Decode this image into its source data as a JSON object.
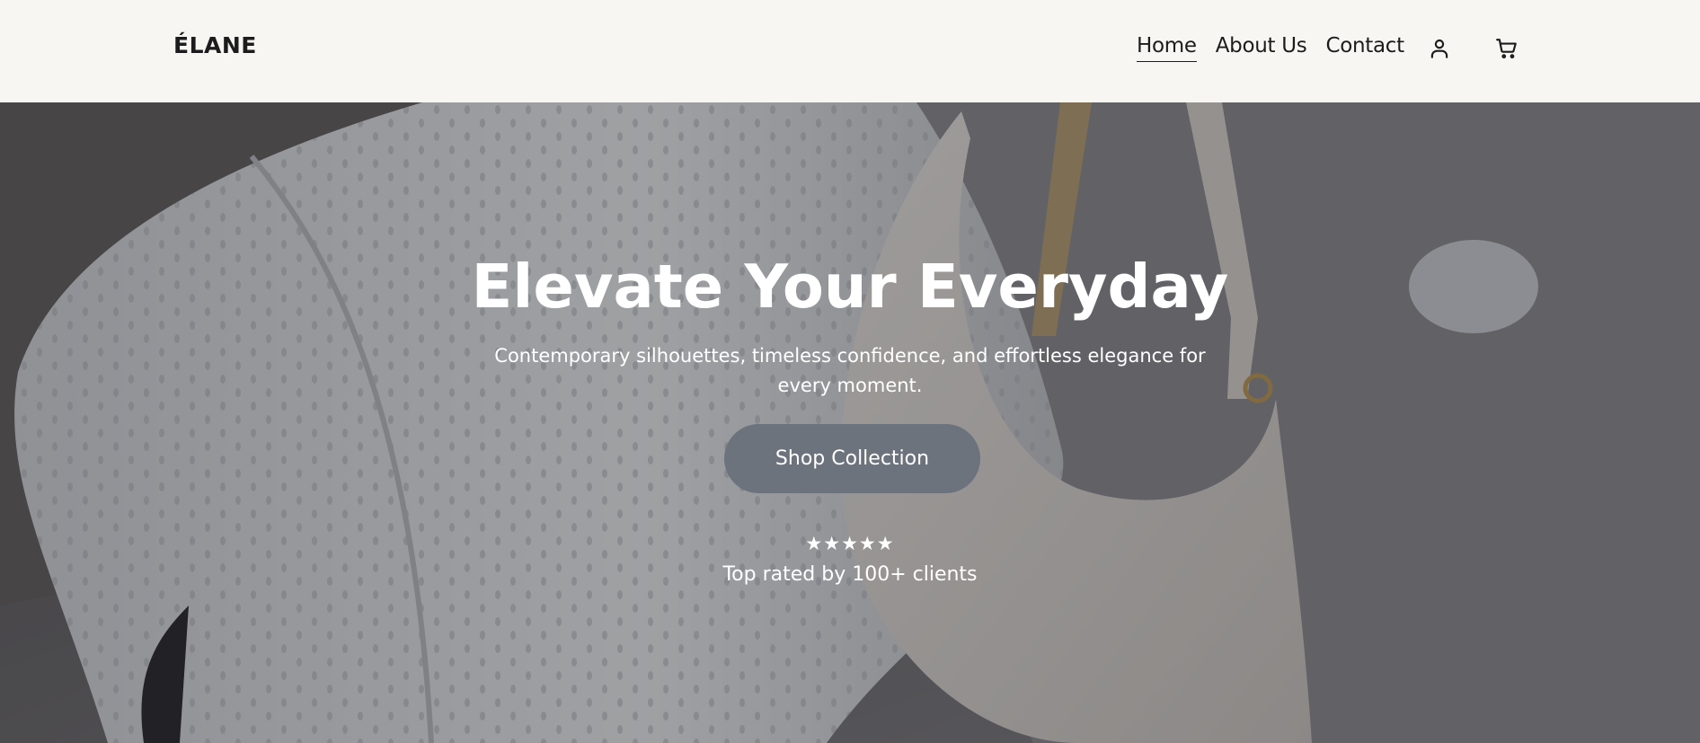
{
  "header": {
    "logo": "ÉLANE",
    "nav": [
      {
        "label": "Home",
        "active": true
      },
      {
        "label": "About Us",
        "active": false
      },
      {
        "label": "Contact",
        "active": false
      }
    ],
    "icons": [
      "user-icon",
      "cart-icon"
    ]
  },
  "hero": {
    "title": "Elevate Your Everyday",
    "subtitle": "Contemporary silhouettes, timeless confidence, and effortless elegance for every moment.",
    "cta_label": "Shop Collection",
    "stars": "★★★★★",
    "rating": 5,
    "rating_text": "Top rated by 100+ clients"
  },
  "colors": {
    "header_bg": "#f7f6f3",
    "text_dark": "#1c1c1c",
    "cta_bg": "#6c737d",
    "hero_text": "#ffffff"
  }
}
